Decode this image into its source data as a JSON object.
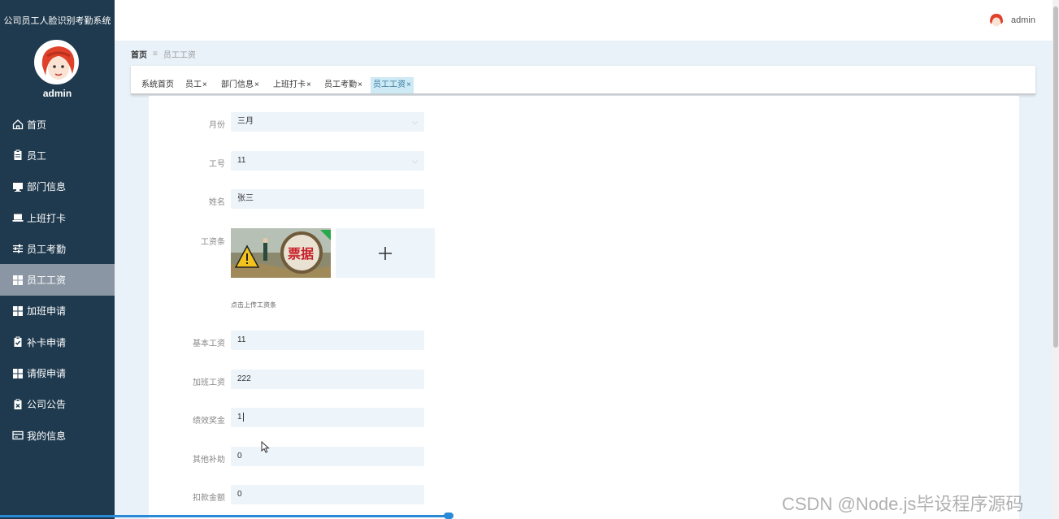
{
  "app": {
    "title": "公司员工人脸识别考勤系统"
  },
  "sidebar": {
    "username": "admin",
    "items": [
      {
        "label": "首页",
        "icon": "home-icon"
      },
      {
        "label": "员工",
        "icon": "clipboard-icon"
      },
      {
        "label": "部门信息",
        "icon": "monitor-icon"
      },
      {
        "label": "上班打卡",
        "icon": "laptop-icon"
      },
      {
        "label": "员工考勤",
        "icon": "sliders-icon"
      },
      {
        "label": "员工工资",
        "icon": "grid-icon",
        "active": true
      },
      {
        "label": "加班申请",
        "icon": "grid-icon"
      },
      {
        "label": "补卡申请",
        "icon": "clipboard-check-icon"
      },
      {
        "label": "请假申请",
        "icon": "grid-icon"
      },
      {
        "label": "公司公告",
        "icon": "clipboard-x-icon"
      },
      {
        "label": "我的信息",
        "icon": "card-icon"
      }
    ]
  },
  "header": {
    "username": "admin"
  },
  "breadcrumb": {
    "home": "首页",
    "separator": "≡",
    "current": "员工工资"
  },
  "tabs": [
    {
      "label": "系统首页",
      "closable": false
    },
    {
      "label": "员工",
      "closable": true
    },
    {
      "label": "部门信息",
      "closable": true
    },
    {
      "label": "上班打卡",
      "closable": true
    },
    {
      "label": "员工考勤",
      "closable": true
    },
    {
      "label": "员工工资",
      "closable": true,
      "active": true
    }
  ],
  "tab_close_glyph": "×",
  "form": {
    "month": {
      "label": "月份",
      "value": "三月"
    },
    "employee_no": {
      "label": "工号",
      "value": "11"
    },
    "name": {
      "label": "姓名",
      "value": "张三"
    },
    "payslip": {
      "label": "工资条",
      "image_text": "票据",
      "hint": "点击上传工资条"
    },
    "base_salary": {
      "label": "基本工资",
      "value": "11"
    },
    "overtime_pay": {
      "label": "加班工资",
      "value": "222"
    },
    "performance_bonus": {
      "label": "绩效奖金",
      "value": "1"
    },
    "other_allowance": {
      "label": "其他补助",
      "value": "0"
    },
    "deduction": {
      "label": "扣款金额",
      "value": "0"
    }
  },
  "watermark": "CSDN @Node.js毕设程序源码",
  "colors": {
    "sidebar": "#1f3a4e",
    "sidebar_active": "#8a96a3",
    "field_bg": "#edf4fa",
    "active_tab": "#cdeaf5"
  }
}
